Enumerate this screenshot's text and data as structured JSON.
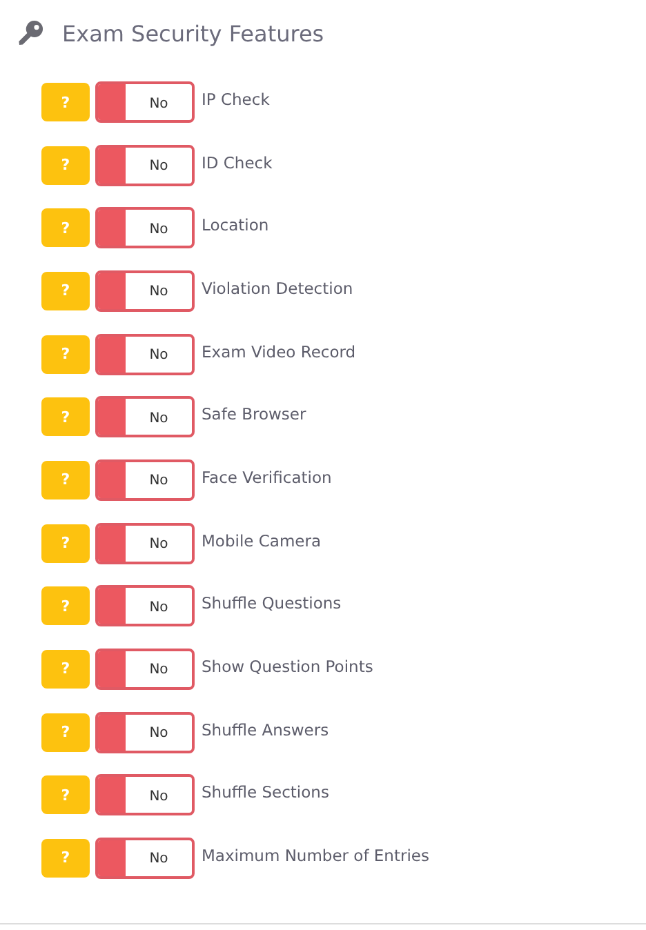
{
  "section": {
    "title": "Exam Security Features"
  },
  "features": [
    {
      "help": "?",
      "on": false,
      "state_label": "No",
      "label": "IP Check"
    },
    {
      "help": "?",
      "on": false,
      "state_label": "No",
      "label": "ID Check"
    },
    {
      "help": "?",
      "on": false,
      "state_label": "No",
      "label": "Location"
    },
    {
      "help": "?",
      "on": false,
      "state_label": "No",
      "label": "Violation Detection"
    },
    {
      "help": "?",
      "on": false,
      "state_label": "No",
      "label": "Exam Video Record"
    },
    {
      "help": "?",
      "on": false,
      "state_label": "No",
      "label": "Safe Browser"
    },
    {
      "help": "?",
      "on": false,
      "state_label": "No",
      "label": "Face Verification"
    },
    {
      "help": "?",
      "on": false,
      "state_label": "No",
      "label": "Mobile Camera"
    },
    {
      "help": "?",
      "on": false,
      "state_label": "No",
      "label": "Shuffle Questions"
    },
    {
      "help": "?",
      "on": false,
      "state_label": "No",
      "label": "Show Question Points"
    },
    {
      "help": "?",
      "on": false,
      "state_label": "No",
      "label": "Shuffle Answers"
    },
    {
      "help": "?",
      "on": false,
      "state_label": "No",
      "label": "Shuffle Sections"
    },
    {
      "help": "?",
      "on": false,
      "state_label": "No",
      "label": "Maximum Number of Entries"
    }
  ]
}
